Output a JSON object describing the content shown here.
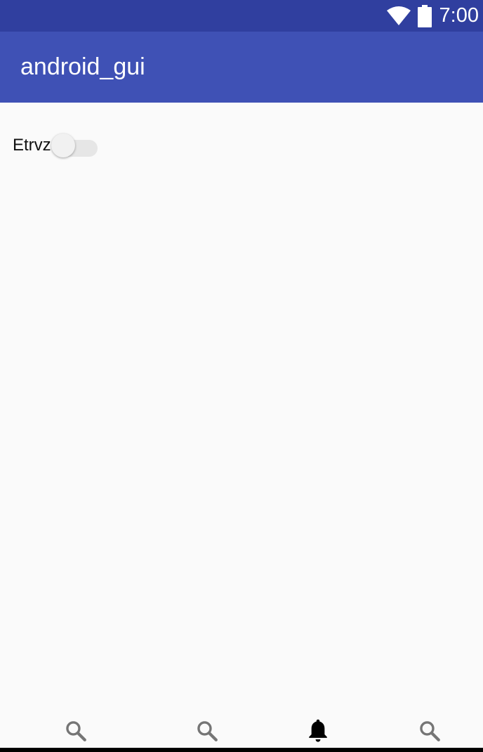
{
  "status_bar": {
    "time": "7:00",
    "icons": [
      "wifi-icon",
      "battery-icon"
    ],
    "background": "#303f9f"
  },
  "app_bar": {
    "title": "android_gui",
    "background": "#3f51b5"
  },
  "content": {
    "switch": {
      "label": "Etrvz",
      "checked": false
    }
  },
  "bottom_nav": {
    "items": [
      {
        "icon": "search-icon",
        "active": false
      },
      {
        "icon": "search-icon",
        "active": false
      },
      {
        "icon": "bell-icon",
        "active": true
      },
      {
        "icon": "search-icon",
        "active": false
      }
    ],
    "active_color": "#000000",
    "inactive_color": "#757575"
  }
}
